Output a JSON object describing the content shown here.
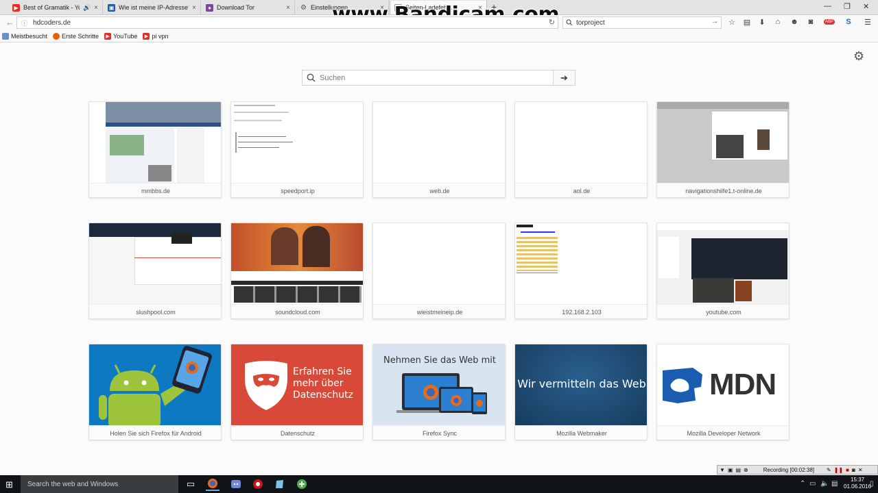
{
  "tabs": [
    {
      "title": "Best of Gramatik - You…",
      "icon": "youtube-icon"
    },
    {
      "title": "Wie ist meine IP-Adresse?",
      "icon": "monitor-icon"
    },
    {
      "title": "Download Tor",
      "icon": "tor-icon"
    },
    {
      "title": "Einstellungen",
      "icon": "gear-icon"
    },
    {
      "title": "Seiten-Ladefehl…",
      "icon": "page-icon"
    }
  ],
  "url": "hdcoders.de",
  "search_engine_query": "torproject",
  "bookmarks": [
    {
      "label": "Meistbesucht",
      "icon": "bookmark-icon"
    },
    {
      "label": "Erste Schritte",
      "icon": "firefox-icon"
    },
    {
      "label": "YouTube",
      "icon": "youtube-icon"
    },
    {
      "label": "pi vpn",
      "icon": "youtube-icon"
    }
  ],
  "watermark": "www.Bandicam.com",
  "newtab_search_placeholder": "Suchen",
  "tiles": [
    {
      "label": "mmbbs.de"
    },
    {
      "label": "speedport.ip"
    },
    {
      "label": "web.de"
    },
    {
      "label": "aol.de"
    },
    {
      "label": "navigationshilfe1.t-online.de"
    },
    {
      "label": "slushpool.com"
    },
    {
      "label": "soundcloud.com"
    },
    {
      "label": "wieistmeineip.de"
    },
    {
      "label": "192.168.2.103"
    },
    {
      "label": "youtube.com"
    },
    {
      "label": "Holen Sie sich Firefox für Android"
    },
    {
      "label": "Datenschutz",
      "text": [
        "Erfahren Sie",
        "mehr über",
        "Datenschutz"
      ]
    },
    {
      "label": "Firefox Sync",
      "text": "Nehmen Sie das Web mit"
    },
    {
      "label": "Mozilla Webmaker",
      "text": "Wir vermitteln das Web"
    },
    {
      "label": "Mozilla Developer Network",
      "text": "MDN"
    }
  ],
  "taskbar": {
    "search_placeholder": "Search the web and Windows",
    "time": "15:37",
    "date": "01.06.2016"
  },
  "recording": "Recording [00:02:38]",
  "colors": {
    "youtube_red": "#e52d27",
    "datenschutz_red": "#d9493a",
    "webmaker_blue": "#1f4e7a",
    "mdn_blue": "#1a5db0",
    "android_blue": "#0d79c2",
    "sync_bg": "#d8e5f1"
  }
}
